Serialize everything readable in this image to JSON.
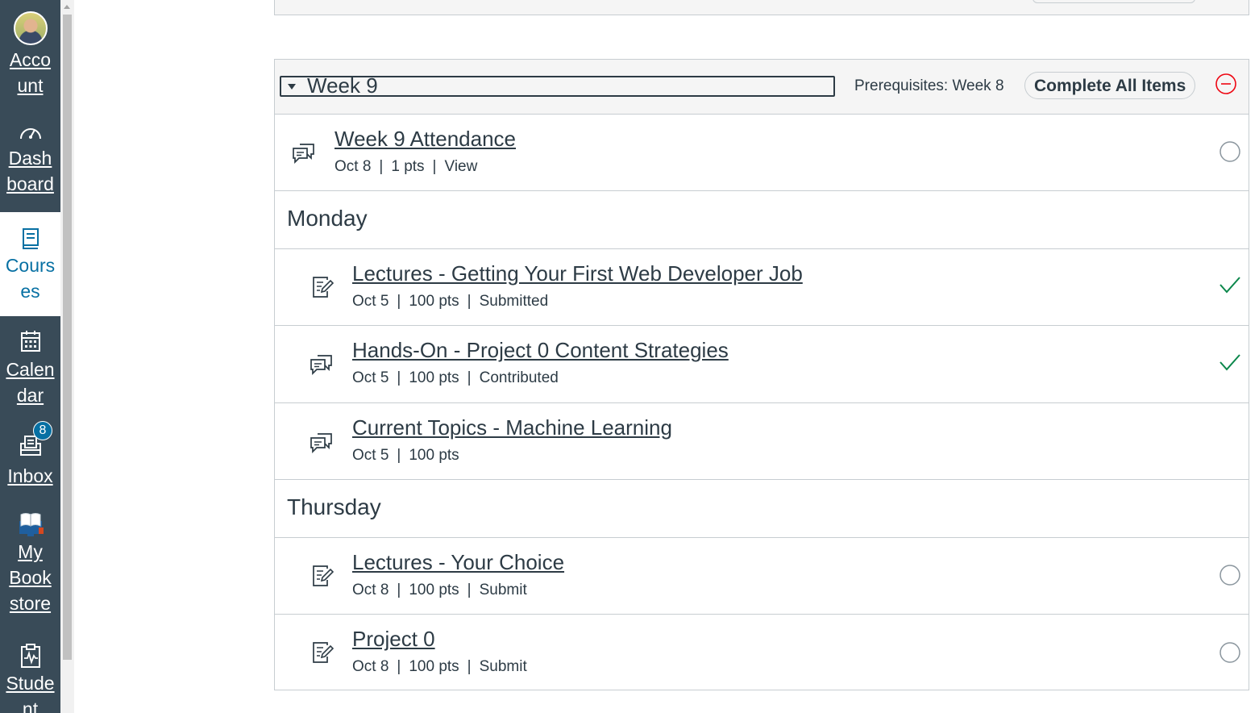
{
  "nav": {
    "account": "Acco unt",
    "dashboard": "Dash board",
    "courses": "Cours es",
    "calendar": "Calen dar",
    "inbox": "Inbox",
    "inbox_badge": "8",
    "bookstore": "My Book store",
    "student": "Stude nt"
  },
  "module": {
    "name": "Week 9",
    "prerequisites": "Prerequisites: Week 8",
    "complete_all": "Complete All Items",
    "items": [
      {
        "title": "Week 9 Attendance",
        "date": "Oct 8",
        "pts": "1 pts",
        "status": "View",
        "icon": "discussion-icon",
        "state": "incomplete"
      },
      {
        "title": "Monday",
        "subheader": true
      },
      {
        "title": "Lectures - Getting Your First Web Developer Job",
        "date": "Oct 5",
        "pts": "100 pts",
        "status": "Submitted",
        "icon": "assignment-icon",
        "state": "complete"
      },
      {
        "title": "Hands-On - Project 0 Content Strategies",
        "date": "Oct 5",
        "pts": "100 pts",
        "status": "Contributed",
        "icon": "discussion-icon",
        "state": "complete"
      },
      {
        "title": "Current Topics - Machine Learning",
        "date": "Oct 5",
        "pts": "100 pts",
        "status": "",
        "icon": "discussion-icon",
        "state": "none"
      },
      {
        "title": "Thursday",
        "subheader": true
      },
      {
        "title": "Lectures - Your Choice",
        "date": "Oct 8",
        "pts": "100 pts",
        "status": "Submit",
        "icon": "assignment-icon",
        "state": "incomplete"
      },
      {
        "title": "Project 0",
        "date": "Oct 8",
        "pts": "100 pts",
        "status": "Submit",
        "icon": "assignment-icon",
        "state": "incomplete"
      }
    ]
  },
  "colors": {
    "nav_bg": "#394b58",
    "accent": "#0770a3",
    "complete": "#0b874b",
    "danger": "#ee0612"
  }
}
